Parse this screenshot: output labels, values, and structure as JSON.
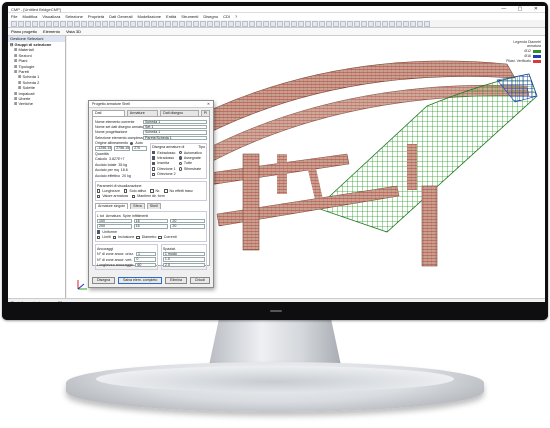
{
  "app": {
    "title": "CMP - [Untitled BridgeCMP]",
    "window_controls": "— ▢ ✕",
    "menu": [
      "File",
      "Modifica",
      "Visualizza",
      "Selezione",
      "Proprietà",
      "Dati Generali",
      "Modellazione",
      "Entità",
      "Strumenti",
      "Disegno",
      "CDI",
      "?"
    ],
    "toolbar2_items": [
      "Piano progetto",
      "Elemento",
      "Vista 3D"
    ]
  },
  "left_panel": {
    "header": "Gestione Selezioni",
    "tree": [
      {
        "label": "Gruppi di selezione",
        "level": 1
      },
      {
        "label": "Materiali",
        "level": 2
      },
      {
        "label": "Sezioni",
        "level": 2
      },
      {
        "label": "Piani",
        "level": 2
      },
      {
        "label": "Tipologie",
        "level": 2
      },
      {
        "label": "Pareti",
        "level": 2
      },
      {
        "label": "Scheda 1",
        "level": 3
      },
      {
        "label": "Scheda 2",
        "level": 3
      },
      {
        "label": "Solette",
        "level": 3
      },
      {
        "label": "Impalcati",
        "level": 2
      },
      {
        "label": "Uberte",
        "level": 2
      },
      {
        "label": "Vertiche",
        "level": 2
      }
    ]
  },
  "legend": {
    "title": "Legenda Diametri armatura",
    "items": [
      {
        "label": "Ø12",
        "color": "#2f8f2a"
      },
      {
        "label": "Ø16",
        "color": "#1c3fb8"
      },
      {
        "label": "Pilast. Verificato",
        "color": "#d63a3a"
      }
    ]
  },
  "dialog": {
    "title": "Progetto armature Shell",
    "close": "✕",
    "tabs": [
      "Dati progettazione",
      "Armature minime",
      "Dati disegno armature",
      "Pl"
    ],
    "fields": [
      {
        "label": "Nome elemento corrente",
        "value": "Scheda 1"
      },
      {
        "label": "Nome set dati disegno armature",
        "value": "Set 1"
      },
      {
        "label": "Nome progettazione",
        "value": "Scheda 1"
      }
    ],
    "selection_label": "Selezione elemento complessivo",
    "selection_value": "Parete/Scheda 1",
    "origin_label": "Origine allineamento",
    "origin_auto": "Auto",
    "origin_coords": [
      "-1256.15",
      "2756.15",
      "270"
    ],
    "draw_group": "Disegna armature di",
    "draw_opts": [
      "Estradosso",
      "Intradosso",
      "Inserita",
      "Direzione 1",
      "Direzione 2"
    ],
    "type_group": "Tipo",
    "type_opts": [
      "Automatico",
      "Assegnate",
      "Tutte",
      "Sfinestrate"
    ],
    "weights_label": "Quantità",
    "weights": [
      {
        "label": "Calcolo",
        "value": "3.827E+7"
      },
      {
        "label": "Acciaio totale",
        "value": "35 kg"
      },
      {
        "label": "Acciaio per mq",
        "value": "18.6"
      },
      {
        "label": "Acciaio effettivo",
        "value": "20 kg"
      }
    ],
    "display_group": "Parametri di visualizzazione",
    "display_opts": [
      "Lunghezze",
      "Solo attivo",
      "Nr.",
      "No effetti trasv.",
      "Valore armatura",
      "Mantieni dir. form"
    ],
    "section_tabs": [
      "Armature singole",
      "Sfera",
      "Shell"
    ],
    "bar_headers": [
      "L tot",
      "Armatura",
      "Spire infittimenti"
    ],
    "bar_rows": [
      [
        "100",
        "16",
        "20"
      ],
      [
        "200",
        "16",
        "20"
      ]
    ],
    "uniform_label": "Uniforme",
    "bar_opts": [
      "Limiti",
      "Inclusione",
      "Diametro",
      "Correnti"
    ],
    "anchor_label": "Ancoraggi",
    "anchor_rows": [
      {
        "label": "N° di zone ancor. orizz.",
        "value": "1"
      },
      {
        "label": "N° di zone ancor. vert.",
        "value": "0"
      },
      {
        "label": "Lunghezza ancoraggio",
        "value": "60"
      }
    ],
    "spacing_label": "Spaziat.",
    "spacing_vals": [
      "1 modo",
      "1.0",
      "2.0"
    ],
    "buttons": [
      "Disegna",
      "Salva elem. completo",
      "Elimina",
      "Chiudi"
    ]
  },
  "status": {
    "text": "Per informazioni, premere F1"
  }
}
